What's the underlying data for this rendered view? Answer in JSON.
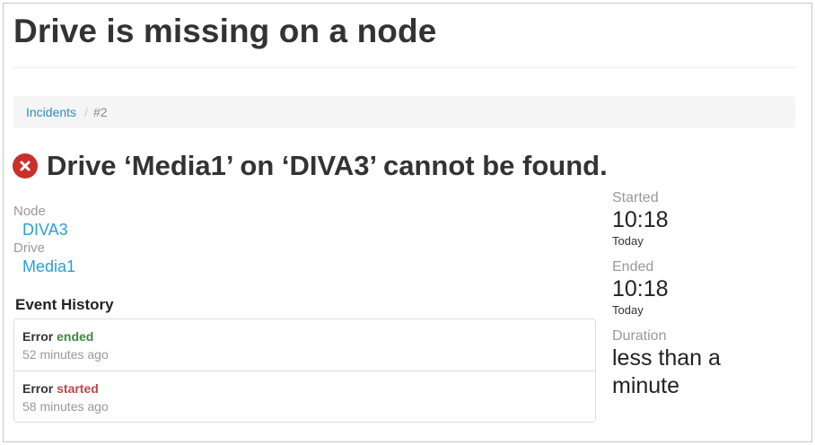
{
  "page": {
    "title": "Drive is missing on a node"
  },
  "breadcrumb": {
    "items": [
      "Incidents"
    ],
    "current": "#2"
  },
  "alert": {
    "title": "Drive ‘Media1’ on ‘DIVA3’ cannot be found.",
    "icon": "error-circle-x-icon",
    "color": "#c9302c"
  },
  "properties": {
    "node_label": "Node",
    "node_value": "DIVA3",
    "drive_label": "Drive",
    "drive_value": "Media1"
  },
  "history": {
    "title": "Event History",
    "events": [
      {
        "subject": "Error",
        "status": "ended",
        "time": "52 minutes ago"
      },
      {
        "subject": "Error",
        "status": "started",
        "time": "58 minutes ago"
      }
    ]
  },
  "summary": {
    "started_label": "Started",
    "started_time": "10:18",
    "started_day": "Today",
    "ended_label": "Ended",
    "ended_time": "10:18",
    "ended_day": "Today",
    "duration_label": "Duration",
    "duration_value": "less than a minute"
  },
  "colors": {
    "link": "#2a9fd6",
    "ended": "#3c8a3c",
    "started": "#b94a48"
  }
}
